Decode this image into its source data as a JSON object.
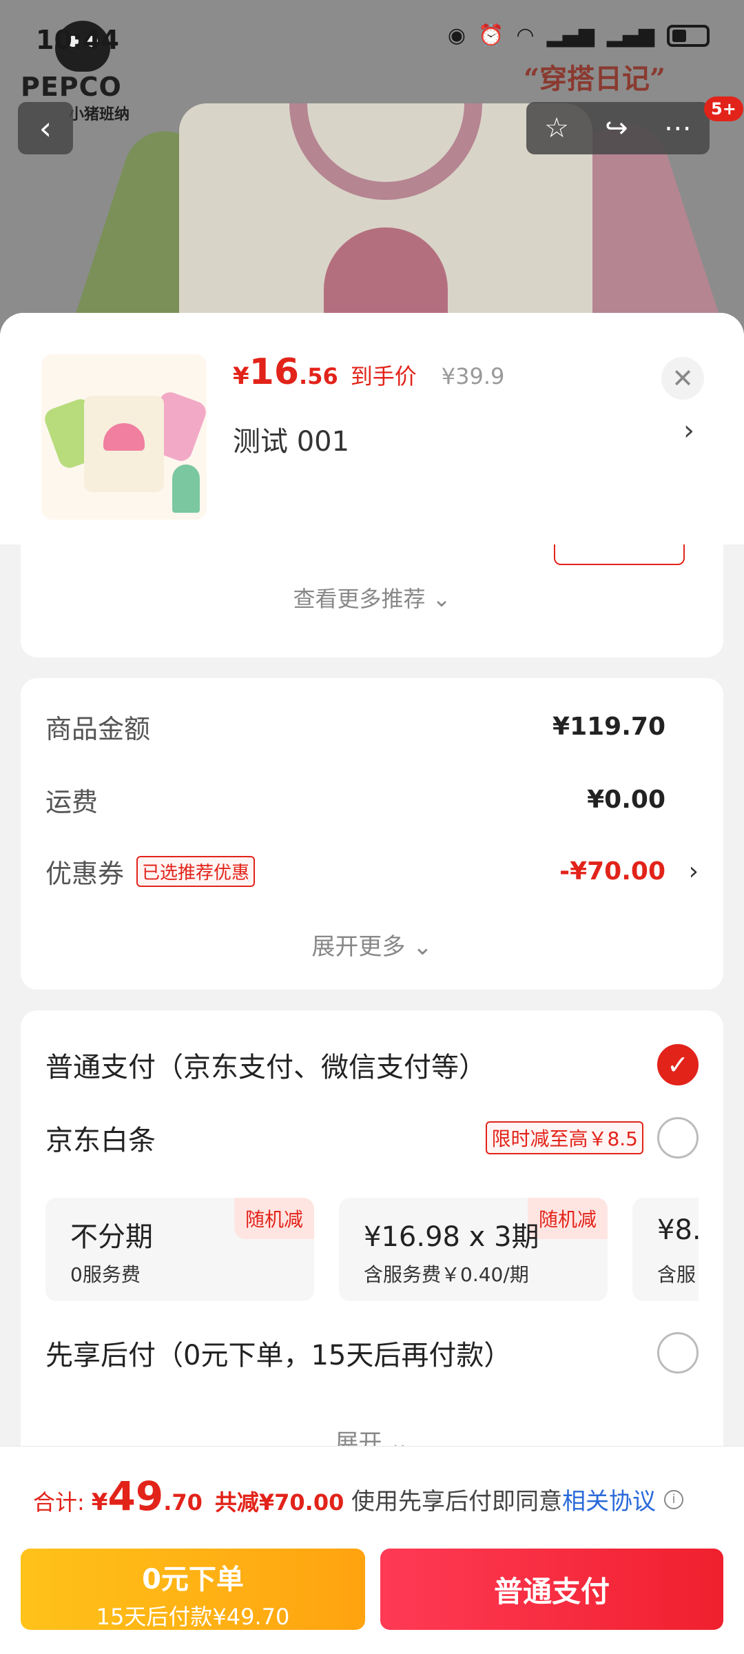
{
  "status_bar": {
    "time": "10:44"
  },
  "background": {
    "brand": "PEPCO",
    "brand_sub": "小猪班纳",
    "headline": "“穿搭日记”",
    "notification_count": "5+"
  },
  "product": {
    "price_yen": "¥",
    "price_int": "16",
    "price_dec": ".56",
    "price_tag": "到手价",
    "original_price": "¥39.9",
    "spec": "测试  001"
  },
  "recommend": {
    "more_label": "查看更多推荐 ⌄"
  },
  "summary": {
    "goods_label": "商品金额",
    "goods_value": "¥119.70",
    "shipping_label": "运费",
    "shipping_value": "¥0.00",
    "coupon_label": "优惠券",
    "coupon_tag": "已选推荐优惠",
    "coupon_value": "-¥70.00",
    "expand_label": "展开更多 ⌄"
  },
  "payment": {
    "normal_label": "普通支付（京东支付、微信支付等）",
    "baitiao_label": "京东白条",
    "baitiao_promo": "限时减至高￥8.5",
    "plans": [
      {
        "title": "不分期",
        "sub": "0服务费",
        "badge": "随机减"
      },
      {
        "title": "¥16.98 x 3期",
        "sub": "含服务费￥0.40/期",
        "badge": "随机减"
      },
      {
        "title": "¥8.",
        "sub": "含服"
      }
    ],
    "later_label": "先享后付（0元下单，15天后再付款）",
    "expand_label": "展开 ⌄"
  },
  "footer": {
    "total_label": "合计:",
    "total_yen": "¥",
    "total_int": "49",
    "total_dec": ".70",
    "total_discount": "共减¥70.00",
    "agree_text": "使用先享后付即同意",
    "agree_link": "相关协议",
    "zero_btn_title": "0元下单",
    "zero_btn_sub": "15天后付款¥49.70",
    "normal_btn": "普通支付"
  },
  "colors": {
    "accent_red": "#e2231a",
    "link_blue": "#2a6ad9",
    "zero_btn_yellow": "#ffb31a"
  }
}
